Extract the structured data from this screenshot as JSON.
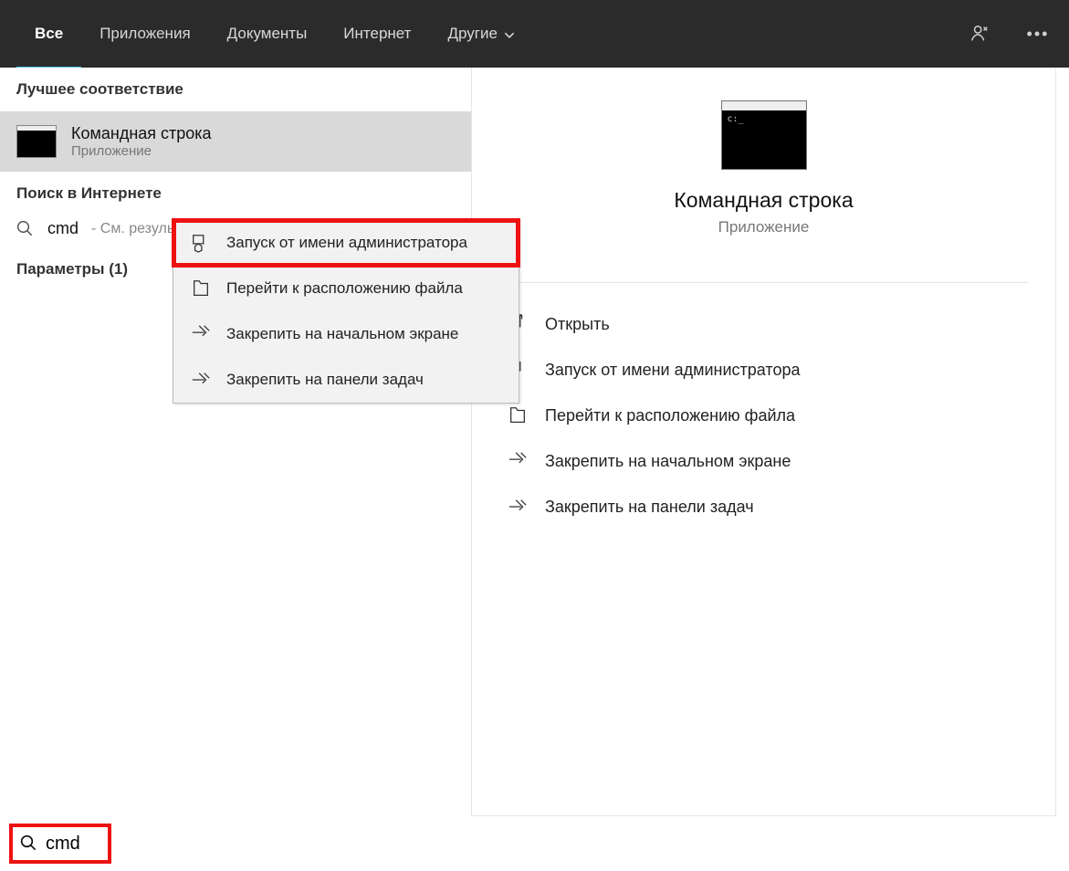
{
  "tabs": {
    "all": "Все",
    "apps": "Приложения",
    "docs": "Документы",
    "internet": "Интернет",
    "more": "Другие"
  },
  "left": {
    "bestMatchHeader": "Лучшее соответствие",
    "bestMatch": {
      "title": "Командная строка",
      "subtitle": "Приложение"
    },
    "internetHeader": "Поиск в Интернете",
    "webResult": {
      "query": "cmd",
      "hint": "- См. результаты в Интернете"
    },
    "settingsHeader": "Параметры (1)"
  },
  "contextMenu": {
    "runAsAdmin": "Запуск от имени администратора",
    "openLocation": "Перейти к расположению файла",
    "pinStart": "Закрепить на начальном экране",
    "pinTaskbar": "Закрепить на панели задач"
  },
  "detail": {
    "title": "Командная строка",
    "type": "Приложение",
    "actions": {
      "open": "Открыть",
      "runAsAdmin": "Запуск от имени администратора",
      "openLocation": "Перейти к расположению файла",
      "pinStart": "Закрепить на начальном экране",
      "pinTaskbar": "Закрепить на панели задач"
    }
  },
  "search": {
    "value": "cmd"
  }
}
